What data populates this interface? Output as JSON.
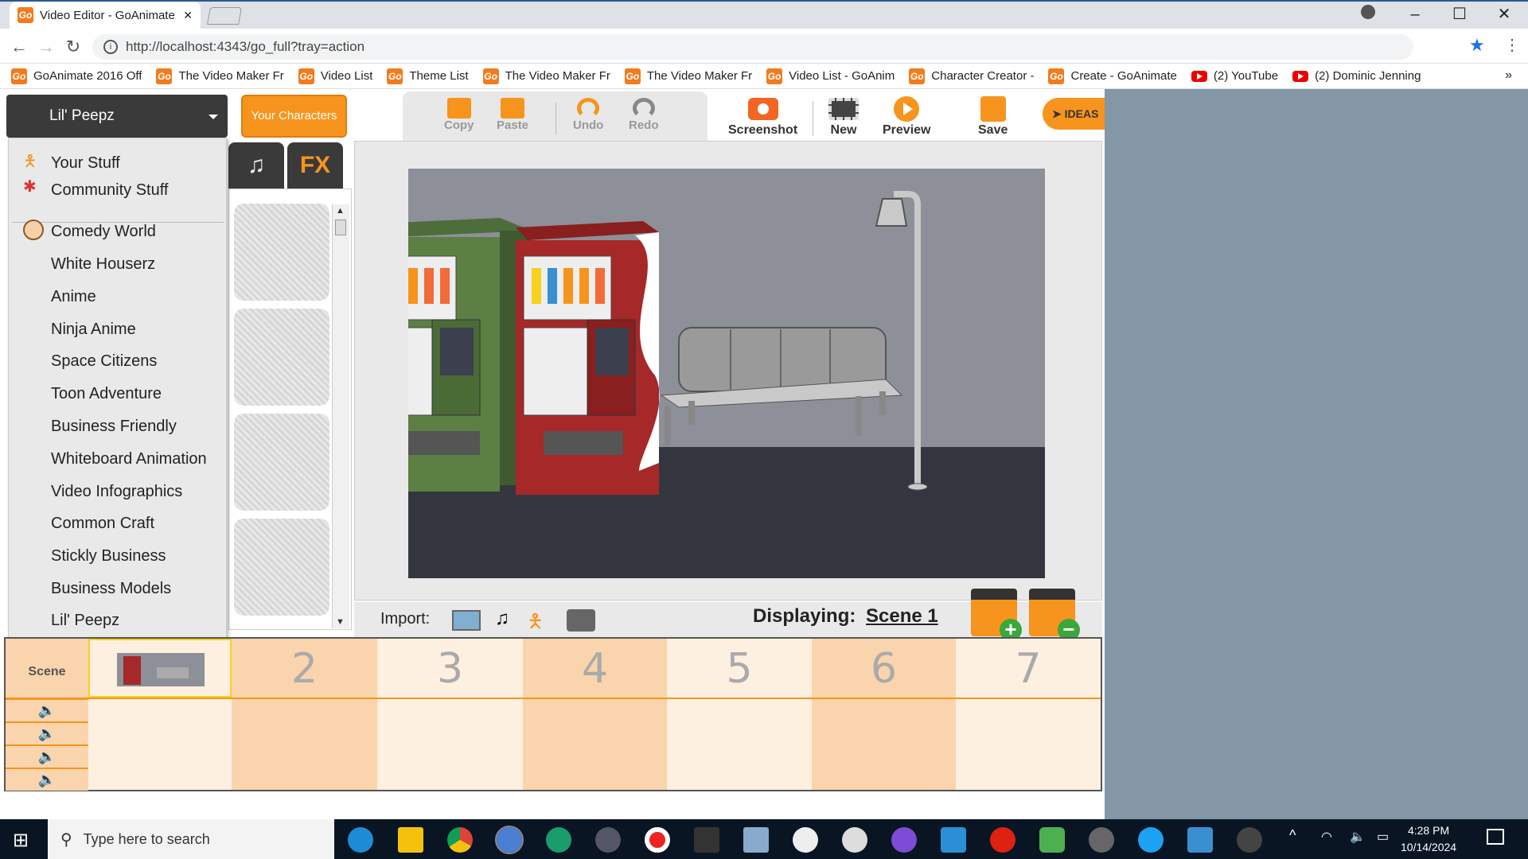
{
  "browser": {
    "tab_title": "Video Editor - GoAnimate",
    "url": "http://localhost:4343/go_full?tray=action",
    "window_controls": [
      "–",
      "☐",
      "✕"
    ],
    "bookmarks": [
      {
        "label": "GoAnimate 2016 Off",
        "icon": "goanimate-icon"
      },
      {
        "label": "The Video Maker Fr",
        "icon": "goanimate-icon"
      },
      {
        "label": "Video List",
        "icon": "goanimate-icon"
      },
      {
        "label": "Theme List",
        "icon": "goanimate-icon"
      },
      {
        "label": "The Video Maker Fr",
        "icon": "goanimate-icon"
      },
      {
        "label": "The Video Maker Fr",
        "icon": "goanimate-icon"
      },
      {
        "label": "Video List - GoAnim",
        "icon": "goanimate-icon"
      },
      {
        "label": "Character Creator -",
        "icon": "goanimate-icon"
      },
      {
        "label": "Create - GoAnimate",
        "icon": "goanimate-icon"
      },
      {
        "label": "(2) YouTube",
        "icon": "youtube-icon"
      },
      {
        "label": "(2) Dominic Jenning",
        "icon": "youtube-icon"
      }
    ],
    "more_bookmarks": "»"
  },
  "editor": {
    "theme_selector": "Lil' Peepz",
    "your_characters": "Your Characters",
    "toolbar_left": [
      {
        "label": "Copy",
        "icon": "copy-icon"
      },
      {
        "label": "Paste",
        "icon": "paste-icon"
      },
      {
        "label": "Undo",
        "icon": "undo-icon"
      },
      {
        "label": "Redo",
        "icon": "redo-icon"
      }
    ],
    "toolbar_right": [
      {
        "label": "Screenshot",
        "icon": "camera-icon"
      },
      {
        "label": "New",
        "icon": "film-icon"
      },
      {
        "label": "Preview",
        "icon": "play-icon"
      },
      {
        "label": "Save",
        "icon": "save-icon"
      }
    ],
    "ideas": "IDEAS",
    "library_tabs": [
      {
        "label": "♫",
        "icon": "music-icon"
      },
      {
        "label": "FX",
        "icon": "fx-icon"
      }
    ],
    "theme_menu": {
      "top_items": [
        "Your Stuff",
        "Community Stuff"
      ],
      "themes": [
        "Comedy World",
        "White Houserz",
        "Anime",
        "Ninja Anime",
        "Space Citizens",
        "Toon Adventure",
        "Business Friendly",
        "Whiteboard Animation",
        "Video Infographics",
        "Common Craft",
        "Stickly Business",
        "Business Models",
        "Lil' Peepz"
      ]
    },
    "import_label": "Import:",
    "displaying_label": "Displaying:",
    "current_scene": "Scene 1",
    "timeline": {
      "scene_label": "Scene",
      "scene_numbers": [
        "2",
        "3",
        "4",
        "5",
        "6",
        "7"
      ]
    }
  },
  "taskbar": {
    "search_placeholder": "Type here to search",
    "time": "4:28 PM",
    "date": "10/14/2024"
  },
  "colors": {
    "accent_orange": "#f7941d",
    "timeline_light": "#fdf0e0",
    "timeline_dark": "#f9d4ac",
    "taskbar": "#0a1524",
    "side_bg": "#8497a6"
  }
}
